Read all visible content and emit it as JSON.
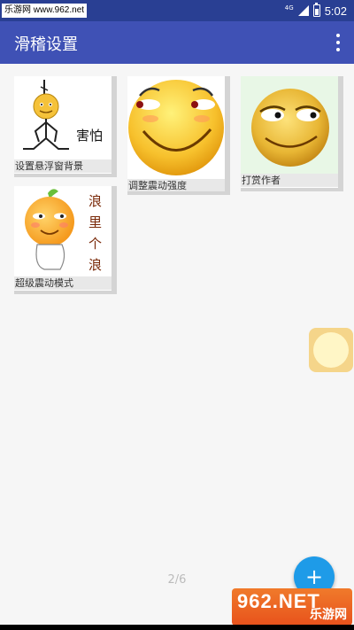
{
  "status_bar": {
    "watermark": "乐游网 www.962.net",
    "network_type": "4G",
    "time": "5:02"
  },
  "app_bar": {
    "title": "滑稽设置",
    "menu_icon": "more-vert-icon"
  },
  "cards": [
    {
      "label": "设置悬浮窗背景",
      "image_text": "害怕"
    },
    {
      "label": "调整震动强度"
    },
    {
      "label": "打赏作者"
    },
    {
      "label": "超级震动模式",
      "image_text": [
        "浪",
        "里",
        "个",
        "浪"
      ]
    }
  ],
  "page_indicator": "2/6",
  "fab": {
    "label": "+",
    "icon": "add-icon"
  },
  "corner_logo": {
    "big": "962.NET",
    "small": "乐游网"
  },
  "colors": {
    "primary": "#3f51b5",
    "status_bar": "#293f93",
    "fab": "#1e9be8",
    "emoji_face": "#f7c12d"
  }
}
